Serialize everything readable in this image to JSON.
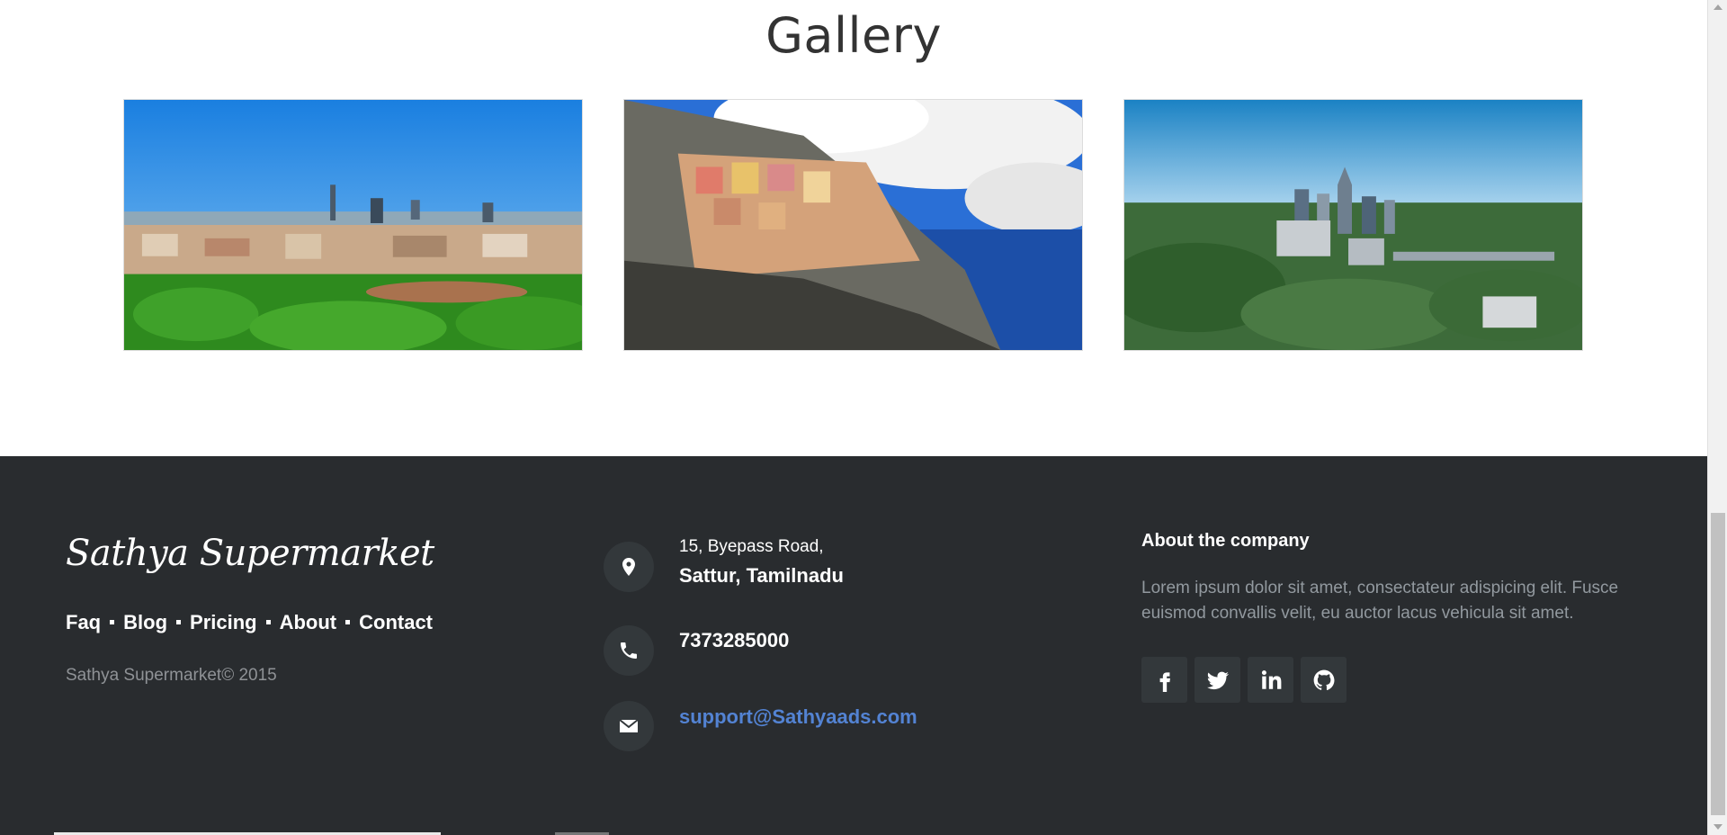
{
  "gallery": {
    "title": "Gallery",
    "images": [
      {
        "subject": "city skyline with park"
      },
      {
        "subject": "coastal cliff village"
      },
      {
        "subject": "aerial city downtown"
      }
    ]
  },
  "footer": {
    "brand": "Sathya Supermarket",
    "links": [
      "Faq",
      "Blog",
      "Pricing",
      "About",
      "Contact"
    ],
    "copyright": "Sathya Supermarket© 2015",
    "address_line1": "15, Byepass Road,",
    "address_line2": "Sattur, Tamilnadu",
    "phone": "7373285000",
    "email": "support@Sathyaads.com",
    "about_title": "About the company",
    "about_text": "Lorem ipsum dolor sit amet, consectateur adispicing elit. Fusce euismod convallis velit, eu auctor lacus vehicula sit amet.",
    "socials": [
      "facebook-icon",
      "twitter-icon",
      "linkedin-icon",
      "github-icon"
    ]
  },
  "colors": {
    "footer_bg": "#292c2f",
    "icon_bg": "#33383b",
    "link_accent": "#5383d3",
    "muted_text": "#92999f"
  }
}
